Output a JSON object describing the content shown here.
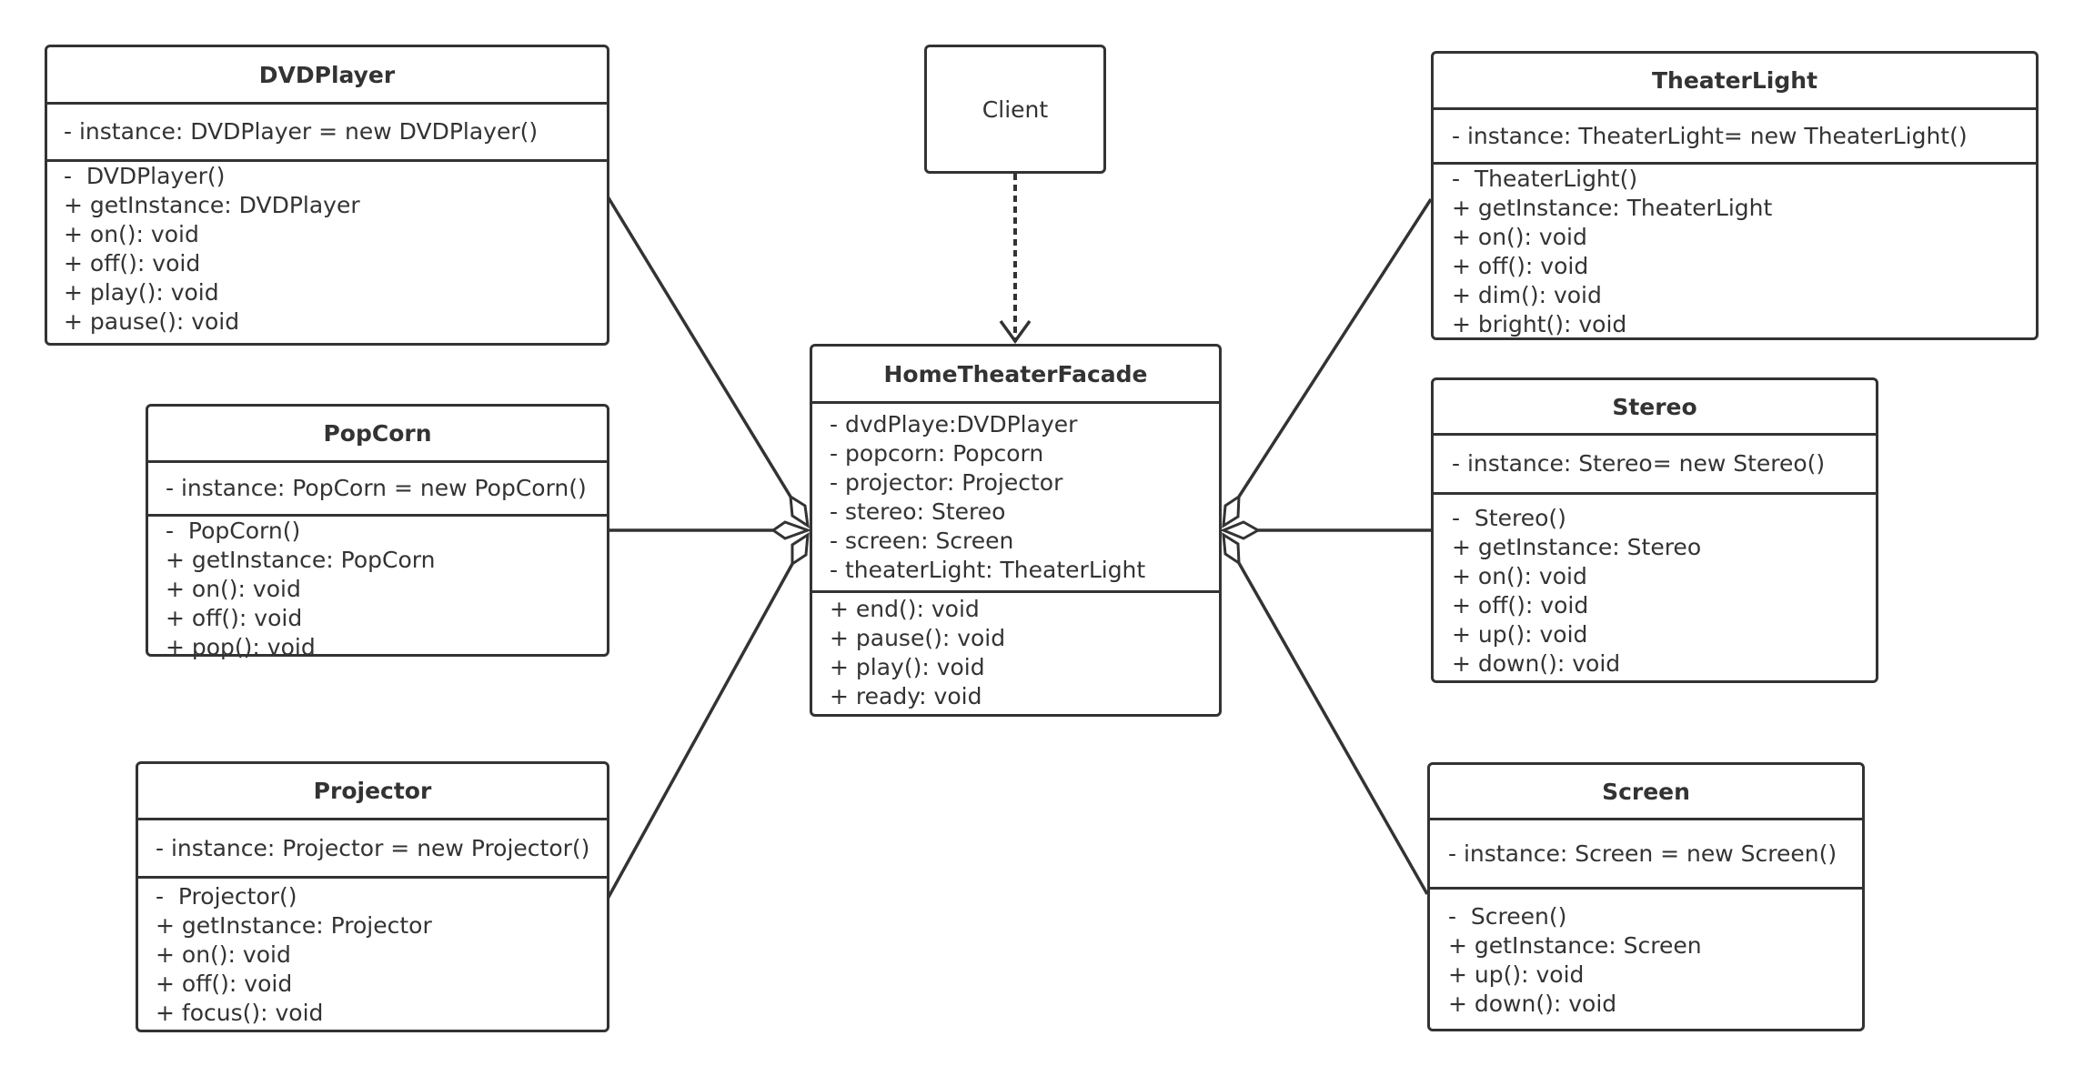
{
  "diagram": {
    "type": "UML class diagram (Facade pattern)",
    "client": {
      "name": "Client"
    },
    "facade": {
      "name": "HomeTheaterFacade",
      "attributes": [
        "- dvdPlaye:DVDPlayer",
        "- popcorn: Popcorn",
        "- projector: Projector",
        "- stereo: Stereo",
        "- screen: Screen",
        "- theaterLight: TheaterLight"
      ],
      "operations": [
        "+ end(): void",
        "+ pause(): void",
        "+ play(): void",
        "+ ready: void"
      ]
    },
    "classes": {
      "dvdplayer": {
        "name": "DVDPlayer",
        "attributes": [
          "- instance: DVDPlayer = new DVDPlayer()"
        ],
        "operations": [
          "-  DVDPlayer()",
          "+ getInstance: DVDPlayer",
          "+ on(): void",
          "+ off(): void",
          "+ play(): void",
          "+ pause(): void"
        ]
      },
      "popcorn": {
        "name": "PopCorn",
        "attributes": [
          "- instance: PopCorn = new PopCorn()"
        ],
        "operations": [
          "-  PopCorn()",
          "+ getInstance: PopCorn",
          "+ on(): void",
          "+ off(): void",
          "+ pop(): void"
        ]
      },
      "projector": {
        "name": "Projector",
        "attributes": [
          "- instance: Projector = new Projector()"
        ],
        "operations": [
          "-  Projector()",
          "+ getInstance: Projector",
          "+ on(): void",
          "+ off(): void",
          "+ focus(): void"
        ]
      },
      "theaterlight": {
        "name": "TheaterLight",
        "attributes": [
          "- instance: TheaterLight= new TheaterLight()"
        ],
        "operations": [
          "-  TheaterLight()",
          "+ getInstance: TheaterLight",
          "+ on(): void",
          "+ off(): void",
          "+ dim(): void",
          "+ bright(): void"
        ]
      },
      "stereo": {
        "name": "Stereo",
        "attributes": [
          "- instance: Stereo= new Stereo()"
        ],
        "operations": [
          "-  Stereo()",
          "+ getInstance: Stereo",
          "+ on(): void",
          "+ off(): void",
          "+ up(): void",
          "+ down(): void"
        ]
      },
      "screen": {
        "name": "Screen",
        "attributes": [
          "- instance: Screen = new Screen()"
        ],
        "operations": [
          "-  Screen()",
          "+ getInstance: Screen",
          "+ up(): void",
          "+ down(): void"
        ]
      }
    },
    "relationships": [
      {
        "from": "Client",
        "to": "HomeTheaterFacade",
        "kind": "dependency",
        "style": "dashed-open-arrow"
      },
      {
        "from": "HomeTheaterFacade",
        "to": "DVDPlayer",
        "kind": "aggregation"
      },
      {
        "from": "HomeTheaterFacade",
        "to": "PopCorn",
        "kind": "aggregation"
      },
      {
        "from": "HomeTheaterFacade",
        "to": "Projector",
        "kind": "aggregation"
      },
      {
        "from": "HomeTheaterFacade",
        "to": "TheaterLight",
        "kind": "aggregation"
      },
      {
        "from": "HomeTheaterFacade",
        "to": "Stereo",
        "kind": "aggregation"
      },
      {
        "from": "HomeTheaterFacade",
        "to": "Screen",
        "kind": "aggregation"
      }
    ],
    "colors": {
      "stroke": "#333333",
      "text": "#333333",
      "background": "#ffffff"
    }
  }
}
